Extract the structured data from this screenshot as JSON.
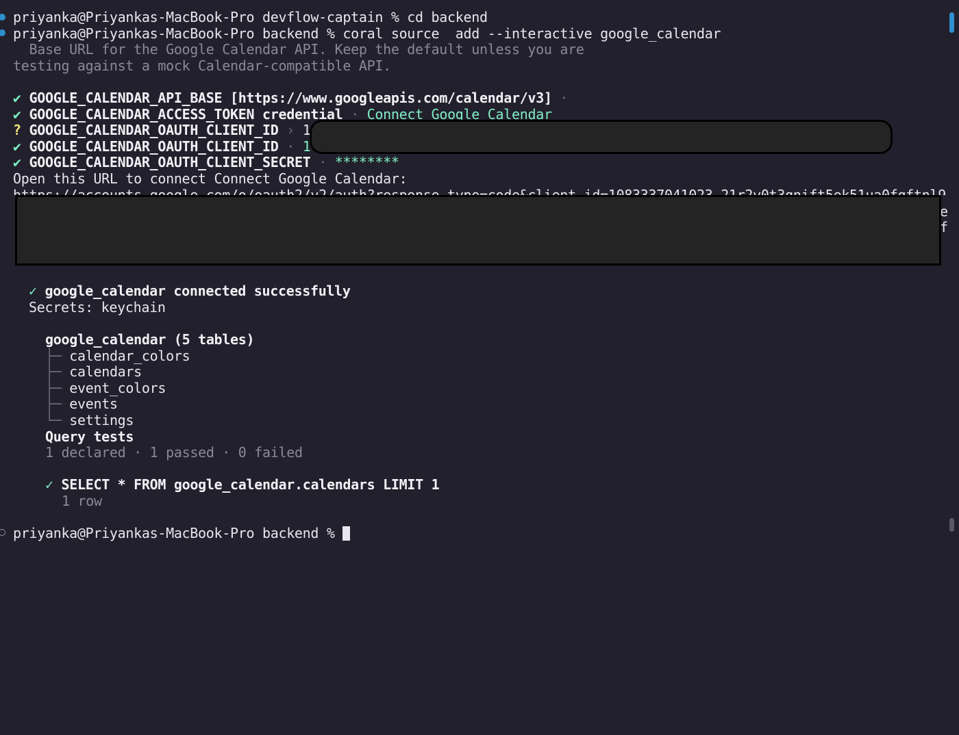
{
  "terminal": {
    "prompt_1": "priyanka@Priyankas-MacBook-Pro devflow-captain % cd backend",
    "prompt_2": "priyanka@Priyankas-MacBook-Pro backend % coral source  add --interactive google_calendar",
    "hint_1": "  Base URL for the Google Calendar API. Keep the default unless you are",
    "hint_2": "testing against a mock Calendar-compatible API.",
    "check_glyph": "✔",
    "question_glyph": "?",
    "api_base_key": "GOOGLE_CALENDAR_API_BASE",
    "api_base_value": "[https://www.googleapis.com/calendar/v3]",
    "access_token_key": "GOOGLE_CALENDAR_ACCESS_TOKEN credential",
    "access_token_sep": "·",
    "access_token_value": "Connect Google Calendar",
    "client_id_prompt_key": "GOOGLE_CALENDAR_OAUTH_CLIENT_ID",
    "client_id_prompt_sep": "›",
    "client_id_prompt_value": "1",
    "client_id_key": "GOOGLE_CALENDAR_OAUTH_CLIENT_ID",
    "client_id_sep": "·",
    "client_id_value": "1",
    "client_secret_key": "GOOGLE_CALENDAR_OAUTH_CLIENT_SECRET",
    "client_secret_sep": "·",
    "client_secret_value": "********",
    "open_url_text": "Open this URL to connect Connect Google Calendar:",
    "url_partial": "https://accounts.google.com/o/oauth2/v2/auth?response_type=code&client_id=1083337041023-21r2v0t3gnift5ek51ua0fqftnl9",
    "wrap_tail_1": "e",
    "wrap_tail_2": "f",
    "success_glyph": "✓",
    "success_text": "google_calendar connected successfully",
    "secrets_text": "Secrets: keychain",
    "tables_header": "google_calendar (5 tables)",
    "tables": [
      {
        "branch": "├─",
        "name": "calendar_colors"
      },
      {
        "branch": "├─",
        "name": "calendars"
      },
      {
        "branch": "├─",
        "name": "event_colors"
      },
      {
        "branch": "├─",
        "name": "events"
      },
      {
        "branch": "└─",
        "name": "settings"
      }
    ],
    "query_tests_header": "Query tests",
    "query_tests_summary": "1 declared · 1 passed · 0 failed",
    "query_text": "SELECT * FROM google_calendar.calendars LIMIT 1",
    "query_result": "1 row",
    "final_prompt": "priyanka@Priyankas-MacBook-Pro backend % "
  },
  "colors": {
    "background": "#22202c",
    "text": "#e8e6ee",
    "green": "#7ff0c6",
    "yellow": "#f3e57a",
    "dim": "#8b8995",
    "marker_blue": "#2d8fc9",
    "scroll_thumb_active": "#2f8fd0",
    "scroll_thumb_idle": "#5a5866",
    "redaction_fill": "#242424"
  }
}
